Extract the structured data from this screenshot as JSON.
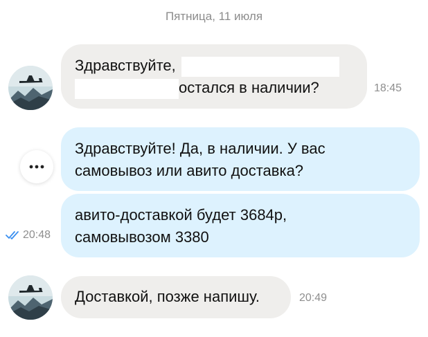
{
  "date_separator": "Пятница, 11 июля",
  "colors": {
    "incoming_bubble": "#efeeec",
    "outgoing_bubble": "#ddf2fe",
    "read_check": "#3a8ff0",
    "muted_text": "#8e8e8e"
  },
  "messages": [
    {
      "direction": "incoming",
      "line1": "Здравствуйте,",
      "line2": "остался в наличии?",
      "time": "18:45",
      "redacted": true
    },
    {
      "direction": "outgoing",
      "line1": "Здравствуйте! Да, в наличии. У вас",
      "line2": "самовывоз или авито доставка?"
    },
    {
      "direction": "outgoing",
      "line1": "авито-доставкой будет 3684р,",
      "line2": "самовывозом 3380",
      "time": "20:48",
      "status": "read"
    },
    {
      "direction": "incoming",
      "line1": "Доставкой, позже напишу.",
      "time": "20:49"
    }
  ],
  "icons": {
    "avatar": "airplane-avatar",
    "more": "more-icon",
    "read_status": "double-check-icon"
  }
}
